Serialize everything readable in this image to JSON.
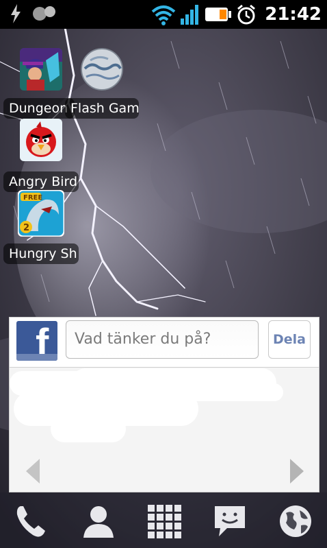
{
  "status_bar": {
    "time": "21:42",
    "icons": [
      "usb-debug-icon",
      "notification-icon",
      "wifi-icon",
      "signal-icon",
      "battery-icon",
      "alarm-icon"
    ]
  },
  "desktop_apps": [
    {
      "label": "Dungeon",
      "icon": "dungeon-game-icon"
    },
    {
      "label": "Flash Gam",
      "icon": "flash-game-globe-icon"
    },
    {
      "label": "Angry Bird",
      "icon": "angry-birds-icon"
    },
    {
      "label": "Hungry Sh",
      "icon": "hungry-shark-icon"
    }
  ],
  "facebook_widget": {
    "status_placeholder": "Vad tänker du på?",
    "share_label": "Dela",
    "brand_color": "#3b5998"
  },
  "dock": {
    "items": [
      "phone-icon",
      "contacts-icon",
      "app-drawer-icon",
      "messaging-icon",
      "browser-icon"
    ]
  }
}
